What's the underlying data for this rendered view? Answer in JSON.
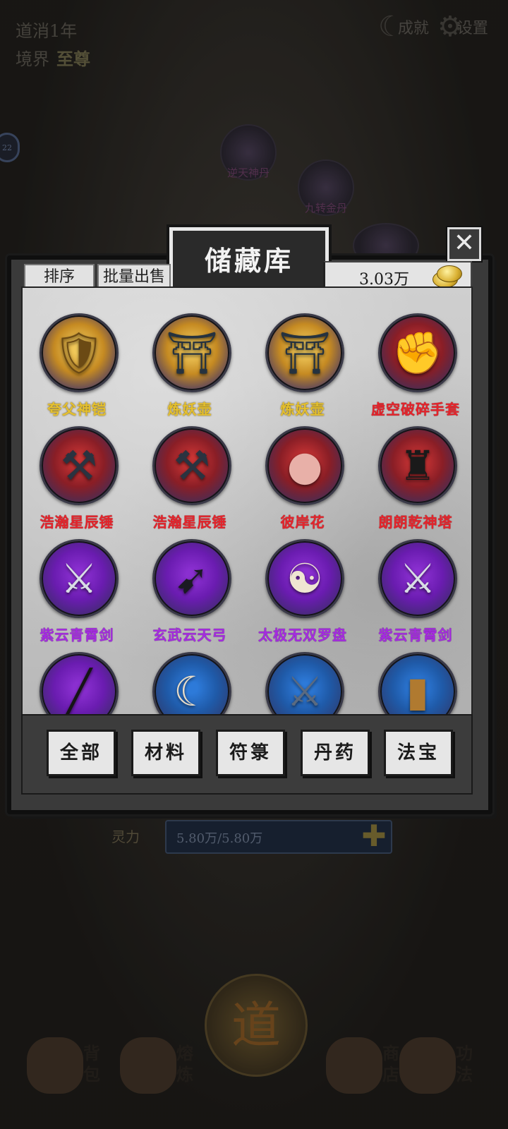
{
  "hud": {
    "daoyun_label": "道消1年",
    "realm_label": "境界",
    "realm_value": "至尊",
    "achievements_label": "成就",
    "settings_label": "设置",
    "side_badge": "22"
  },
  "background_nodes": {
    "node1": "逆天神丹",
    "node2": "九转金丹"
  },
  "lingli": {
    "label": "灵力",
    "value": "5.80万/5.80万"
  },
  "dao_button": "道",
  "bottom_nav": [
    {
      "label": "背包",
      "icon": "bag-icon"
    },
    {
      "label": "熔炼",
      "icon": "furnace-icon"
    },
    {
      "label": "商店",
      "icon": "scroll-icon"
    },
    {
      "label": "功法",
      "icon": "book-icon"
    }
  ],
  "panel": {
    "title": "储藏库",
    "close": "✕",
    "sort_label": "排序",
    "batch_sell_label": "批量出售",
    "currency": "3.03万",
    "currency_icon": "gold-ingot-icon"
  },
  "items": [
    {
      "name": "夸父神铠",
      "rarity": "gold",
      "icon": "armor-icon"
    },
    {
      "name": "炼妖壶",
      "rarity": "gold",
      "icon": "pagoda-lantern-icon"
    },
    {
      "name": "炼妖壶",
      "rarity": "gold",
      "icon": "pagoda-lantern-icon"
    },
    {
      "name": "虚空破碎手套",
      "rarity": "red",
      "icon": "gauntlet-icon"
    },
    {
      "name": "浩瀚星辰锤",
      "rarity": "red",
      "icon": "hammer-icon"
    },
    {
      "name": "浩瀚星辰锤",
      "rarity": "red",
      "icon": "hammer-icon"
    },
    {
      "name": "彼岸花",
      "rarity": "red",
      "icon": "orb-icon"
    },
    {
      "name": "朗朗乾神塔",
      "rarity": "red",
      "icon": "tower-icon"
    },
    {
      "name": "紫云青霄剑",
      "rarity": "purple",
      "icon": "sword-icon"
    },
    {
      "name": "玄武云天弓",
      "rarity": "purple",
      "icon": "bow-icon"
    },
    {
      "name": "太极无双罗盘",
      "rarity": "purple",
      "icon": "taiji-compass-icon"
    },
    {
      "name": "紫云青霄剑",
      "rarity": "purple",
      "icon": "sword-icon"
    },
    {
      "name": "",
      "rarity": "purple",
      "icon": "staff-icon"
    },
    {
      "name": "",
      "rarity": "blue",
      "icon": "scythe-icon"
    },
    {
      "name": "",
      "rarity": "blue",
      "icon": "blade-icon"
    },
    {
      "name": "",
      "rarity": "blue",
      "icon": "club-icon"
    }
  ],
  "categories": [
    "全部",
    "材料",
    "符箓",
    "丹药",
    "法宝"
  ],
  "colors": {
    "gold": "#e5c02e",
    "red": "#e4242c",
    "purple": "#a52be0"
  }
}
